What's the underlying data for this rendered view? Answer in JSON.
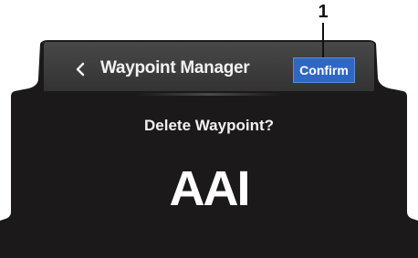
{
  "callout": {
    "number": "1"
  },
  "header": {
    "title": "Waypoint Manager",
    "back_icon": "chevron-left-icon",
    "confirm_label": "Confirm"
  },
  "dialog": {
    "title": "Delete Waypoint?",
    "waypoint_name": "AAI"
  },
  "colors": {
    "screen_background": "#1b1919",
    "header_background": "#3a3a3a",
    "bezel": "#222222",
    "confirm_button": "#2f67c2",
    "text": "#f2f2f2"
  }
}
